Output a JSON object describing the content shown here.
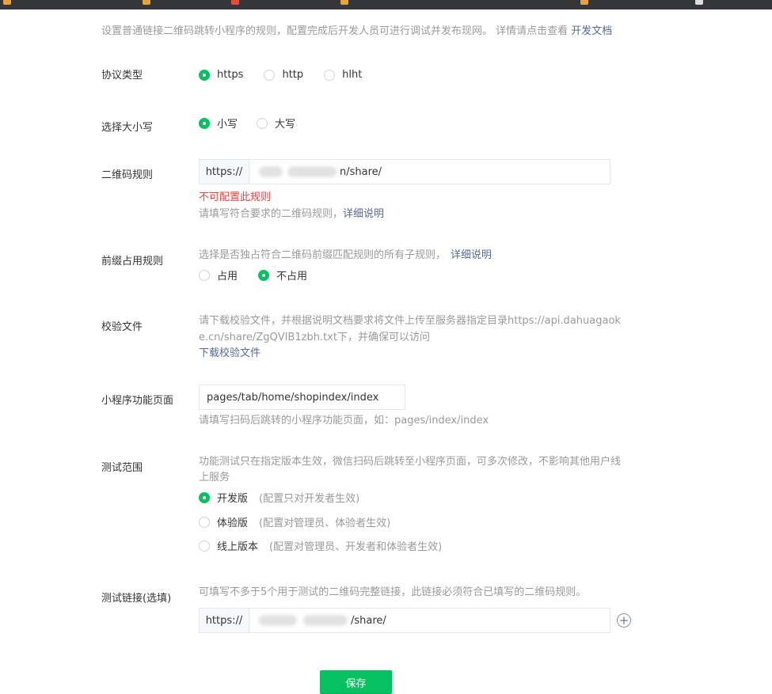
{
  "intro": {
    "text": "设置普通链接二维码跳转小程序的规则，配置完成后开发人员可进行调试并发布现网。 详情请点击查看 ",
    "link": "开发文档"
  },
  "protocol": {
    "label": "协议类型",
    "options": [
      "https",
      "http",
      "hlht"
    ],
    "selected": "https"
  },
  "case": {
    "label": "选择大小写",
    "options": [
      "小写",
      "大写"
    ],
    "selected": "小写"
  },
  "qr_rule": {
    "label": "二维码规则",
    "prefix": "https://",
    "value_suffix": "n/share/",
    "error": "不可配置此规则",
    "hint": "请填写符合要求的二维码规则，",
    "hint_link": "详细说明"
  },
  "prefix_rule": {
    "label": "前缀占用规则",
    "hint": "选择是否独占符合二维码前缀匹配规则的所有子规则，",
    "hint_link": "详细说明",
    "options": [
      "占用",
      "不占用"
    ],
    "selected": "不占用"
  },
  "verify_file": {
    "label": "校验文件",
    "hint_line1": "请下载校验文件，并根据说明文档要求将文件上传至服务器指定目录https://api.dahuagaok",
    "hint_line2": "e.cn/share/ZgQVIB1zbh.txt下，并确保可以访问",
    "download_link": "下载校验文件"
  },
  "page": {
    "label": "小程序功能页面",
    "value": "pages/tab/home/shopindex/index",
    "hint": "请填写扫码后跳转的小程序功能页面，如：pages/index/index"
  },
  "test_scope": {
    "label": "测试范围",
    "hint_line1": "功能测试只在指定版本生效，微信扫码后跳转至小程序页面，可多次修改，不影响其他用户线",
    "hint_line2": "上服务",
    "options": [
      {
        "label": "开发版",
        "desc": "(配置只对开发者生效)"
      },
      {
        "label": "体验版",
        "desc": "(配置对管理员、体验者生效)"
      },
      {
        "label": "线上版本",
        "desc": "(配置对管理员、开发者和体验者生效)"
      }
    ],
    "selected": "开发版"
  },
  "test_link": {
    "label": "测试链接(选填)",
    "hint": "可填写不多于5个用于测试的二维码完整链接，此链接必须符合已填写的二维码规则。",
    "prefix": "https://",
    "value_suffix": "/share/"
  },
  "save_label": "保存",
  "colors": {
    "accent": "#07c160",
    "link": "#576b95",
    "error": "#e64340",
    "hint": "#9a9a9a"
  }
}
